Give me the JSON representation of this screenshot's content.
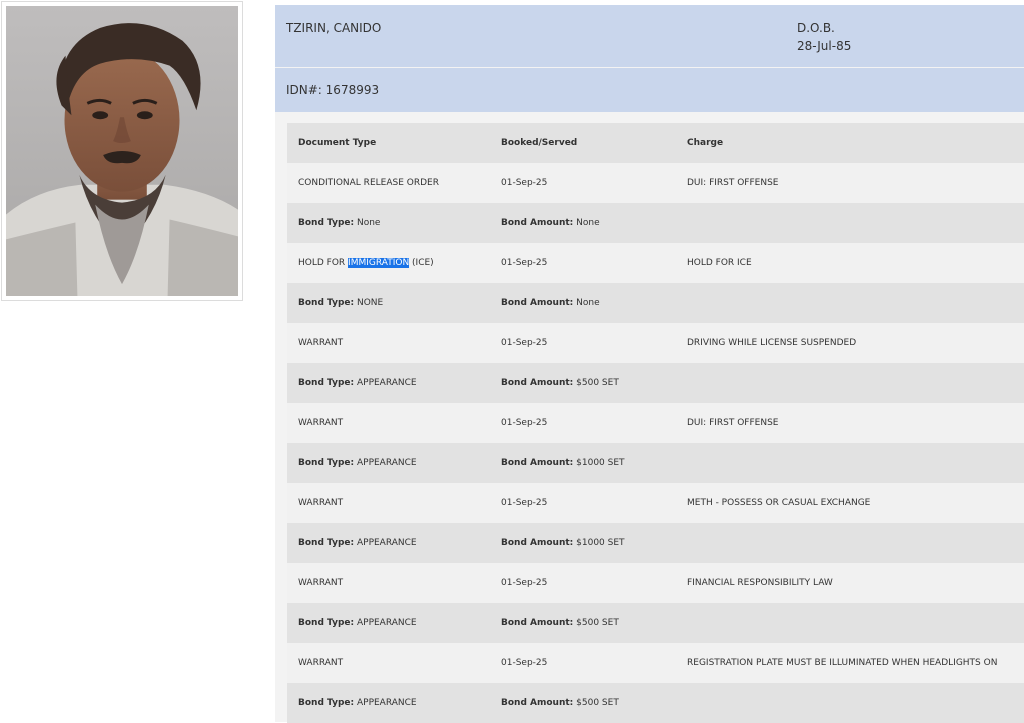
{
  "inmate": {
    "name": "TZIRIN, CANIDO",
    "dob_label": "D.O.B.",
    "dob": "28-Jul-85",
    "idn": "IDN#: 1678993"
  },
  "table": {
    "headers": {
      "document_type": "Document Type",
      "booked_served": "Booked/Served",
      "charge": "Charge"
    },
    "bond_type_label": "Bond Type:",
    "bond_amount_label": "Bond Amount:",
    "rows": [
      {
        "kind": "doc",
        "document": "CONDITIONAL RELEASE ORDER",
        "booked": "01-Sep-25",
        "charge": "DUI: FIRST OFFENSE"
      },
      {
        "kind": "bond",
        "bond_type": "None",
        "bond_amount": "None"
      },
      {
        "kind": "doc",
        "document_pre": "HOLD FOR ",
        "document_sel": "IMMIGRATION",
        "document_post": " (ICE)",
        "booked": "01-Sep-25",
        "charge": "HOLD FOR ICE"
      },
      {
        "kind": "bond",
        "bond_type": "NONE",
        "bond_amount": "None"
      },
      {
        "kind": "doc",
        "document": "WARRANT",
        "booked": "01-Sep-25",
        "charge": "DRIVING WHILE LICENSE SUSPENDED"
      },
      {
        "kind": "bond",
        "bond_type": "APPEARANCE",
        "bond_amount": "$500 SET"
      },
      {
        "kind": "doc",
        "document": "WARRANT",
        "booked": "01-Sep-25",
        "charge": "DUI: FIRST OFFENSE"
      },
      {
        "kind": "bond",
        "bond_type": "APPEARANCE",
        "bond_amount": "$1000 SET"
      },
      {
        "kind": "doc",
        "document": "WARRANT",
        "booked": "01-Sep-25",
        "charge": "METH - POSSESS OR CASUAL EXCHANGE"
      },
      {
        "kind": "bond",
        "bond_type": "APPEARANCE",
        "bond_amount": "$1000 SET"
      },
      {
        "kind": "doc",
        "document": "WARRANT",
        "booked": "01-Sep-25",
        "charge": "FINANCIAL RESPONSIBILITY LAW"
      },
      {
        "kind": "bond",
        "bond_type": "APPEARANCE",
        "bond_amount": "$500 SET"
      },
      {
        "kind": "doc",
        "document": "WARRANT",
        "booked": "01-Sep-25",
        "charge": "REGISTRATION PLATE MUST BE ILLUMINATED WHEN HEADLIGHTS ON"
      },
      {
        "kind": "bond",
        "bond_type": "APPEARANCE",
        "bond_amount": "$500 SET"
      }
    ]
  }
}
